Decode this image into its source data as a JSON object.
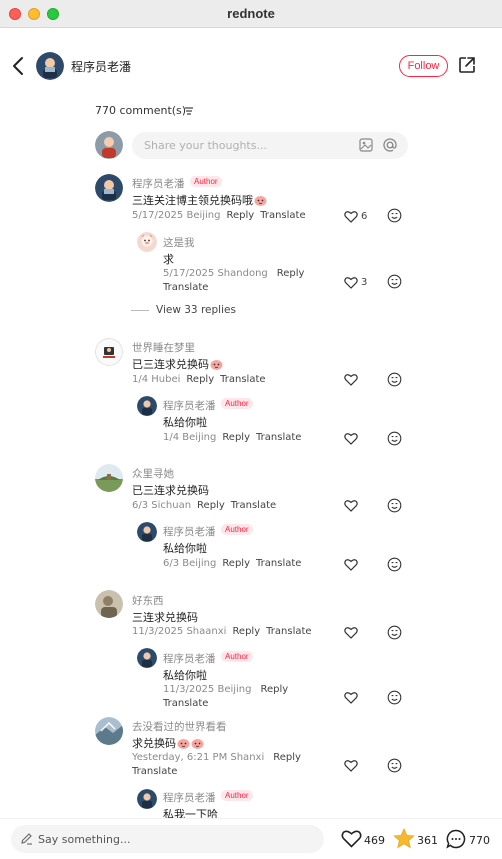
{
  "window": {
    "title": "rednote"
  },
  "header": {
    "author_name": "程序员老潘",
    "follow_label": "Follow"
  },
  "comments_header": {
    "count_label": "770 comment(s)"
  },
  "composer": {
    "placeholder": "Share your thoughts..."
  },
  "comments": [
    {
      "name": "程序员老潘",
      "badge": "Author",
      "text": "三连关注博主领兑换码哦",
      "date": "5/17/2025 Beijing",
      "reply": "Reply",
      "translate": "Translate",
      "likes": "6",
      "replies": [
        {
          "name": "这是我",
          "text": "求",
          "date": "5/17/2025 Shandong",
          "reply": "Reply",
          "translate": "Translate",
          "likes": "3"
        }
      ],
      "view_more": "View 33 replies"
    },
    {
      "name": "世界睡在梦里",
      "text": "已三连求兑换码",
      "date": "1/4 Hubei",
      "reply": "Reply",
      "translate": "Translate",
      "replies": [
        {
          "name": "程序员老潘",
          "badge": "Author",
          "text": "私给你啦",
          "date": "1/4 Beijing",
          "reply": "Reply",
          "translate": "Translate"
        }
      ]
    },
    {
      "name": "众里寻她",
      "text": "已三连求兑换码",
      "date": "6/3 Sichuan",
      "reply": "Reply",
      "translate": "Translate",
      "replies": [
        {
          "name": "程序员老潘",
          "badge": "Author",
          "text": "私给你啦",
          "date": "6/3 Beijing",
          "reply": "Reply",
          "translate": "Translate"
        }
      ]
    },
    {
      "name": "好东西",
      "text": "三连求兑换码",
      "date": "11/3/2025 Shaanxi",
      "reply": "Reply",
      "translate": "Translate",
      "replies": [
        {
          "name": "程序员老潘",
          "badge": "Author",
          "text": "私给你啦",
          "date": "11/3/2025 Beijing",
          "reply": "Reply",
          "translate": "Translate"
        }
      ]
    },
    {
      "name": "去没看过的世界看看",
      "text": "求兑换码",
      "date": "Yesterday, 6:21 PM Shanxi",
      "reply": "Reply",
      "translate": "Translate",
      "replies": [
        {
          "name": "程序员老潘",
          "badge": "Author",
          "text": "私我一下哈"
        }
      ]
    }
  ],
  "bottom_bar": {
    "placeholder": "Say something...",
    "likes": "469",
    "collects": "361",
    "comments": "770"
  },
  "colors": {
    "accent": "#ff2442",
    "star": "#f5b82e"
  }
}
